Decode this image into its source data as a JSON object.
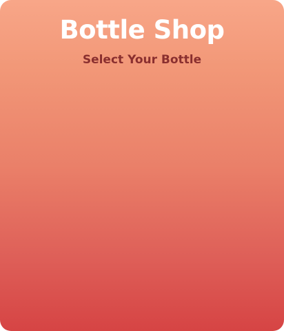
{
  "header": {
    "title": "Bottle Shop",
    "subtitle": "Select Your Bottle"
  },
  "colors": {
    "gradient_top": "#f8a688",
    "gradient_bottom": "#d64444",
    "title_color": "#ffffff",
    "subtitle_color": "#8a2f2f"
  }
}
